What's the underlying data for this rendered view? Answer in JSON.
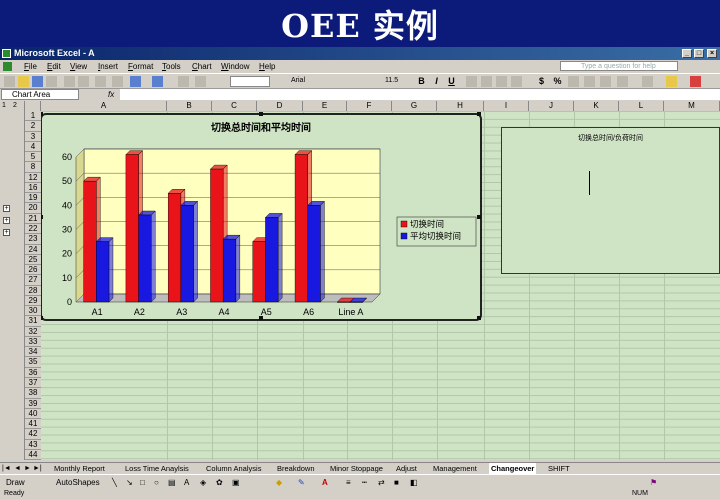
{
  "slide_title": "OEE 实例",
  "window": {
    "title": "Microsoft Excel - A"
  },
  "menu": [
    "File",
    "Edit",
    "View",
    "Insert",
    "Format",
    "Tools",
    "Chart",
    "Window",
    "Help"
  ],
  "ask_placeholder": "Type a question for help",
  "toolbar": {
    "font": "Arial",
    "size": "11.5",
    "bold": "B",
    "italic": "I",
    "underline": "U",
    "currency": "$",
    "percent": "%"
  },
  "name_box": "Chart Area",
  "fx": "fx",
  "outline_levels": [
    "1",
    "2"
  ],
  "columns": [
    "A",
    "B",
    "C",
    "D",
    "E",
    "F",
    "G",
    "H",
    "I",
    "J",
    "K",
    "L",
    "M"
  ],
  "rows": [
    "1",
    "2",
    "3",
    "4",
    "5",
    "8",
    "12",
    "16",
    "19",
    "20",
    "21",
    "22",
    "23",
    "24",
    "25",
    "26",
    "27",
    "28",
    "29",
    "30",
    "31",
    "32",
    "33",
    "34",
    "35",
    "36",
    "37",
    "38",
    "39",
    "40",
    "41",
    "42",
    "43",
    "44"
  ],
  "chart_data": {
    "type": "bar",
    "title": "切换总时间和平均时间",
    "categories": [
      "A1",
      "A2",
      "A3",
      "A4",
      "A5",
      "A6",
      "Line A"
    ],
    "series": [
      {
        "name": "切换时间",
        "values": [
          50,
          61,
          45,
          55,
          25,
          61,
          0
        ],
        "color": "#e8141a"
      },
      {
        "name": "平均切换时间",
        "values": [
          25,
          36,
          40,
          26,
          35,
          40,
          0
        ],
        "color": "#1818e0"
      }
    ],
    "yticks": [
      "0",
      "10",
      "20",
      "30",
      "40",
      "50",
      "60"
    ],
    "ylim": [
      0,
      60
    ],
    "legend_position": "right",
    "plot_background": "#ffffc0"
  },
  "chart2_title": "切换总时间/负荷时间",
  "sheet_tabs": [
    "Monthly Report",
    "Loss Time Anaylsis",
    "Column Analysis",
    "Breakdown",
    "Minor Stoppage",
    "Adjust",
    "Management",
    "Changeover",
    "SHIFT"
  ],
  "active_tab": "Changeover",
  "draw": {
    "draw_label": "Draw",
    "autoshapes": "AutoShapes"
  },
  "status": {
    "left": "Ready",
    "right": "NUM"
  }
}
